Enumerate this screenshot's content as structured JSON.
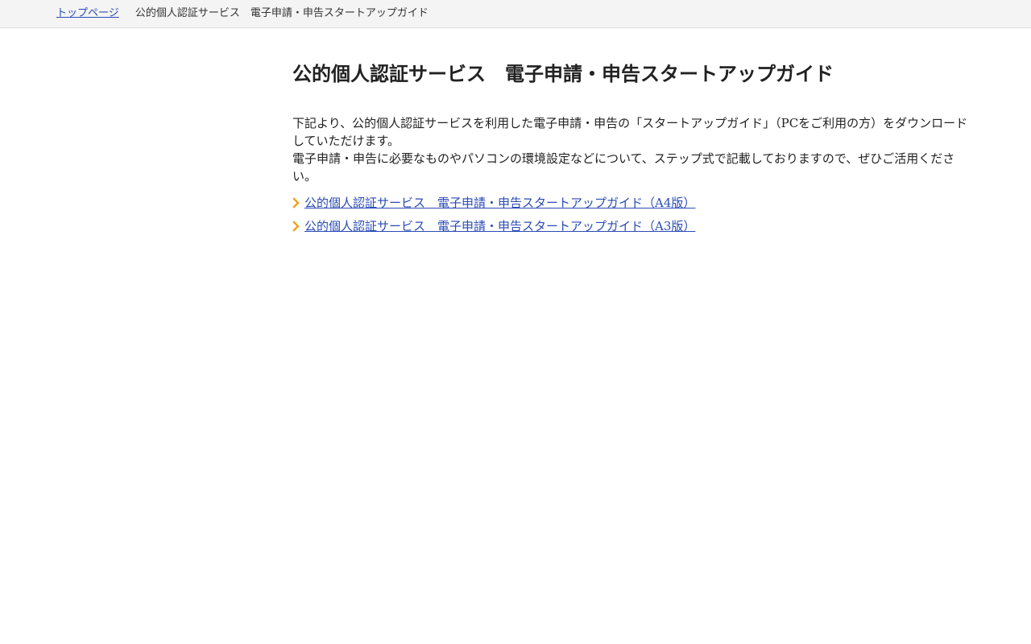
{
  "breadcrumb": {
    "home_label": "トップページ",
    "current_label": "公的個人認証サービス　電子申請・申告スタートアップガイド"
  },
  "main": {
    "title": "公的個人認証サービス　電子申請・申告スタートアップガイド",
    "intro_line1": "下記より、公的個人認証サービスを利用した電子申請・申告の「スタートアップガイド」（PCをご利用の方）をダウンロードしていただけます。",
    "intro_line2": "電子申請・申告に必要なものやパソコンの環境設定などについて、ステップ式で記載しておりますので、ぜひご活用ください。",
    "links": [
      {
        "label": "公的個人認証サービス　電子申請・申告スタートアップガイド（A4版）",
        "icon": "chevron-right-icon"
      },
      {
        "label": "公的個人認証サービス　電子申請・申告スタートアップガイド（A3版）",
        "icon": "chevron-right-icon"
      }
    ]
  },
  "colors": {
    "link": "#2a4bb5",
    "chevron": "#f0a020",
    "breadcrumb_bg": "#f4f4f4",
    "text": "#222222"
  }
}
